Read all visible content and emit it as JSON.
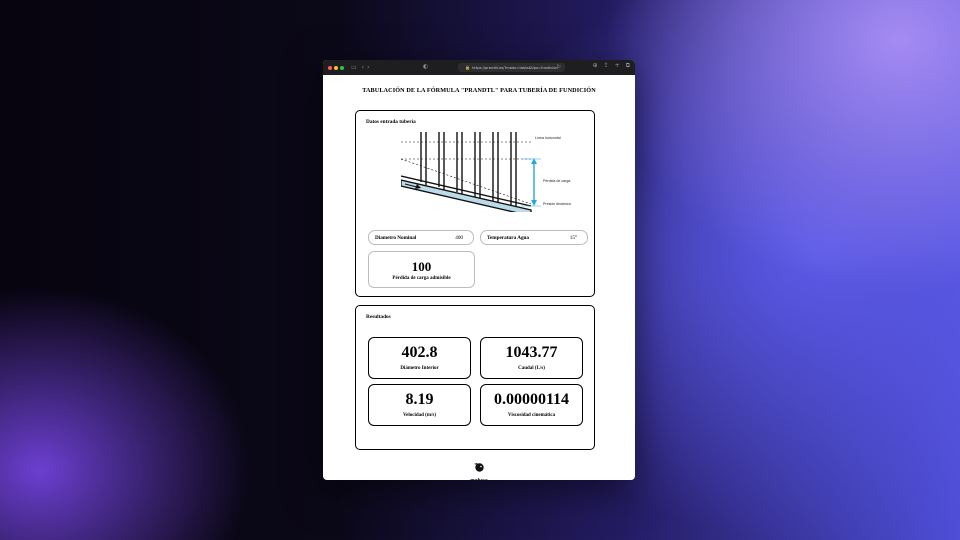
{
  "browser": {
    "url": "https://prandtl.es/?modo=tabla&tipo=fundicion",
    "traffic_lights": [
      "#ff5f57",
      "#febc2e",
      "#28c840"
    ],
    "icons": [
      "sidebar-icon",
      "back-icon",
      "forward-icon",
      "shield-icon",
      "lock-icon",
      "reload-icon",
      "download-icon",
      "share-icon",
      "new-tab-icon",
      "tabs-icon"
    ]
  },
  "page": {
    "title": "TABULACIÓN DE LA FÓRMULA \"PRANDTL\" PARA TUBERÍA DE FUNDICIÓN"
  },
  "input_panel": {
    "title": "Datos entrada tubería",
    "diagram_labels": {
      "horizontal": "Línea horizontal",
      "loss": "Pérdida de carga",
      "pressure": "Presión dinámica"
    },
    "nominal_diameter": {
      "label": "Diametro Nominal",
      "value": "400"
    },
    "water_temperature": {
      "label": "Temperatura Agua",
      "value": "15°"
    },
    "allowed_loss": {
      "value": "100",
      "label": "Pérdida de carga admisible"
    }
  },
  "results_panel": {
    "title": "Resultados",
    "items": [
      {
        "value": "402.8",
        "label": "Diámetro Interior"
      },
      {
        "value": "1043.77",
        "label": "Caudal (L/s)"
      },
      {
        "value": "8.19",
        "label": "Velocidad (m/s)"
      },
      {
        "value": "0.00000114",
        "label": "Viscosidad cinemática"
      }
    ]
  },
  "footer": {
    "brand": "mafusa"
  },
  "colors": {
    "accent_arrow": "#2aa7dd",
    "pipe_fill": "#bcdbe9"
  }
}
